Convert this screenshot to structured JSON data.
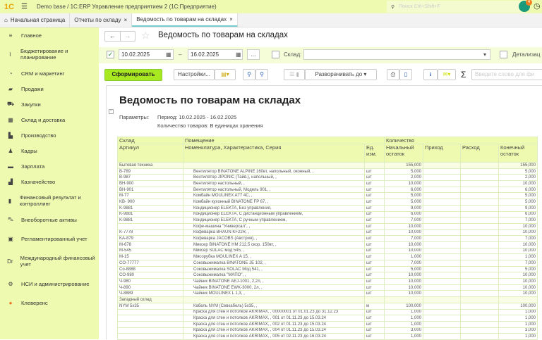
{
  "app": {
    "title": "Demo base / 1С:ERP Управление предприятием 2  (1С:Предприятие)",
    "search_placeholder": "Поиск Ctrl+Shift+F",
    "notif_count": "4",
    "logo": "1С"
  },
  "tabs": [
    {
      "label": "Начальная страница"
    },
    {
      "label": "Отчеты по складу",
      "close": "×"
    },
    {
      "label": "Ведомость по товарам на складах",
      "close": "×"
    }
  ],
  "sidebar": [
    {
      "label": "Главное",
      "icon": "≡"
    },
    {
      "label": "Бюджетирование и планирование",
      "icon": "⌇"
    },
    {
      "label": "CRM и маркетинг",
      "icon": "◔"
    },
    {
      "label": "Продажи",
      "icon": "▰"
    },
    {
      "label": "Закупки",
      "icon": "⛟"
    },
    {
      "label": "Склад и доставка",
      "icon": "▦"
    },
    {
      "label": "Производство",
      "icon": "▙"
    },
    {
      "label": "Кадры",
      "icon": "♟"
    },
    {
      "label": "Зарплата",
      "icon": "▬"
    },
    {
      "label": "Казначейство",
      "icon": "▟"
    },
    {
      "label": "Финансовый результат и контроллинг",
      "icon": "▮"
    },
    {
      "label": "Внеоборотные активы",
      "icon": "⛍"
    },
    {
      "label": "Регламентированный учет",
      "icon": "▣"
    },
    {
      "label": "Международный финансовый учет",
      "icon": "Dr"
    },
    {
      "label": "НСИ и администрирование",
      "icon": "⚙"
    },
    {
      "label": "Клеверенс",
      "icon": "●"
    }
  ],
  "page": {
    "title": "Ведомость по товарам на складах",
    "date_from": "10.02.2025",
    "date_to": "16.02.2025",
    "dash": "–",
    "dots": "...",
    "warehouse_label": "Склад:",
    "warehouse_value": "",
    "detail_label": "Детализац",
    "generate": "Сформировать",
    "settings": "Настройки...",
    "expand": "Разворачивать до",
    "search_placeholder": "Введите слово для фи",
    "sigma": "Σ"
  },
  "report": {
    "title": "Ведомость по товарам на складах",
    "params_label": "Параметры:",
    "period": "Период: 10.02.2025 - 16.02.2025",
    "qty": "Количество товаров: В единицах хранения",
    "headers": {
      "warehouse": "Склад",
      "room": "Помещение",
      "quantity": "Количество",
      "article": "Артикул",
      "nomen": "Номенклатура, Характеристика, Серия",
      "unit": "Ед. изм.",
      "start": "Начальный остаток",
      "in": "Приход",
      "out": "Расход",
      "end": "Конечный остаток"
    },
    "rows": [
      {
        "g": 1,
        "a": "Бытовая техника",
        "s": "155,000",
        "e": "155,000"
      },
      {
        "a": "B-789",
        "n": "Вентилятор BINATONE ALPINE 160вт, напольный, оконный, ,",
        "u": "шт",
        "s": "5,000",
        "e": "5,000"
      },
      {
        "a": "B-987",
        "n": "Вентилятор JIPONIC (Тайв.), напольный, ,",
        "u": "шт",
        "s": "2,000",
        "e": "2,000"
      },
      {
        "a": "BH-900",
        "n": "Вентилятор настольный, ,",
        "u": "шт",
        "s": "10,000",
        "e": "10,000"
      },
      {
        "a": "BH-901",
        "n": "Вентилятор настольный, Модель 901, ,",
        "u": "шт",
        "s": "6,000",
        "e": "6,000"
      },
      {
        "a": "M-77",
        "n": "Комбайн MOULINEX  A77 4C, ,",
        "u": "шт",
        "s": "5,000",
        "e": "5,000"
      },
      {
        "a": "KB- 900",
        "n": "Комбайн кухонный BINATONE FP 67, ,",
        "u": "шт",
        "s": "5,000",
        "e": "5,000"
      },
      {
        "a": "K-9881",
        "n": "Кондиционер ELEKTA, Без управления,",
        "u": "шт",
        "s": "9,000",
        "e": "9,000"
      },
      {
        "a": "K-9881",
        "n": "Кондиционер ELEKTA, С дистанционным управлением,",
        "u": "шт",
        "s": "6,000",
        "e": "6,000"
      },
      {
        "a": "K-9881",
        "n": "Кондиционер ELEKTA, С ручным управлением,",
        "u": "шт",
        "s": "7,000",
        "e": "7,000"
      },
      {
        "a": "",
        "n": "Кофе-машина \"Универсал\", ,",
        "u": "шт",
        "s": "10,000",
        "e": "10,000"
      },
      {
        "a": "K-7778",
        "n": "Кофеварка BRAUN KF22R, ,",
        "u": "шт",
        "s": "10,000",
        "e": "10,000"
      },
      {
        "a": "KA-879",
        "n": "Кофеварка JACOBS (Австрия), ,",
        "u": "шт",
        "s": "7,000",
        "e": "7,000"
      },
      {
        "a": "M-678",
        "n": "Миксер BINATONE HM 212,5 скор. 150вт, ,",
        "u": "шт",
        "s": "10,000",
        "e": "10,000"
      },
      {
        "a": "M-545",
        "n": "Миксер SOLAC мод 545, ,",
        "u": "шт",
        "s": "10,000",
        "e": "10,000"
      },
      {
        "a": "M-15",
        "n": "Мясорубка MOULINEX  A 15, ,",
        "u": "шт",
        "s": "1,000",
        "e": "1,000"
      },
      {
        "a": "CO-77777",
        "n": "Соковыжималка  BINATONE JE 102, ,",
        "u": "шт",
        "s": "7,000",
        "e": "7,000"
      },
      {
        "a": "Co-8888",
        "n": "Соковыжималка  SOLAC  Мод 541, ,",
        "u": "шт",
        "s": "5,000",
        "e": "5,000"
      },
      {
        "a": "CO-980",
        "n": "Соковыжималка \"МАПО\", ,",
        "u": "шт",
        "s": "10,000",
        "e": "10,000"
      },
      {
        "a": "Ч-980",
        "n": "Чайник BINATONE  AEJ-1001,  2,2л, ,",
        "u": "шт",
        "s": "10,000",
        "e": "10,000"
      },
      {
        "a": "Ч-890",
        "n": "Чайник BINATONE  EWK-3000,  2л, ,",
        "u": "шт",
        "s": "10,000",
        "e": "10,000"
      },
      {
        "a": "Ч-8889",
        "n": "Чайник MOULINEX L 1,3, ,",
        "u": "шт",
        "s": "10,000",
        "e": "10,000"
      },
      {
        "g": 1,
        "a": "Западный склад"
      },
      {
        "a": "NYM 5x35",
        "n": "Кабель NYM (Севкабель) 5x35, ,",
        "u": "м",
        "s": "100,000",
        "e": "100,000"
      },
      {
        "a": "",
        "n": "Краска для стен и потолков AKRIMAX, , 00000001 от 01.01.23 до 31.12.23",
        "u": "шт",
        "s": "1,000",
        "e": "1,000"
      },
      {
        "a": "",
        "n": "Краска для стен и потолков AKRIMAX, , 001 от 01.11.23 до 15.03.24",
        "u": "шт",
        "s": "1,000",
        "e": "1,000"
      },
      {
        "a": "",
        "n": "Краска для стен и потолков AKRIMAX, , 002 от 01.11.23 до 15.03.24",
        "u": "шт",
        "s": "1,000",
        "e": "1,000"
      },
      {
        "a": "",
        "n": "Краска для стен и потолков AKRIMAX, , 004 от 01.11.23 до 15.03.24",
        "u": "шт",
        "s": "3,000",
        "e": "3,000"
      },
      {
        "a": "",
        "n": "Краска для стен и потолков AKRIMAX, , 005 от 02.11.23 до 16.03.24",
        "u": "шт",
        "s": "1,000",
        "e": "1,000"
      }
    ]
  }
}
